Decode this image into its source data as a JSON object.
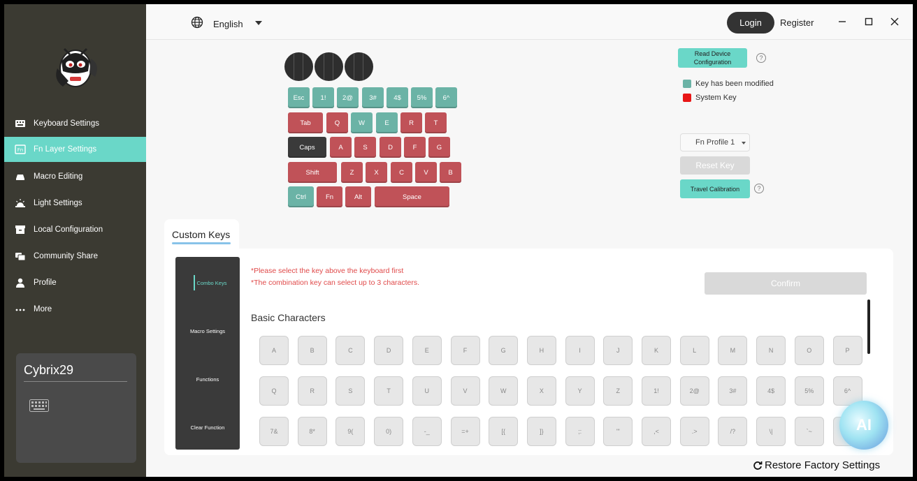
{
  "sidebar": {
    "items": [
      {
        "label": "Keyboard Settings",
        "icon": "keyboard-icon",
        "active": false
      },
      {
        "label": "Fn Layer Settings",
        "icon": "fn-icon",
        "active": true
      },
      {
        "label": "Macro Editing",
        "icon": "macro-icon",
        "active": false
      },
      {
        "label": "Light Settings",
        "icon": "light-icon",
        "active": false
      },
      {
        "label": "Local Configuration",
        "icon": "archive-icon",
        "active": false
      },
      {
        "label": "Community Share",
        "icon": "share-icon",
        "active": false
      },
      {
        "label": "Profile",
        "icon": "user-icon",
        "active": false
      },
      {
        "label": "More",
        "icon": "more-icon",
        "active": false
      }
    ],
    "device": {
      "name": "Cybrix29"
    }
  },
  "topbar": {
    "language": "English",
    "login": "Login",
    "register": "Register"
  },
  "keyboard": {
    "rows": [
      [
        {
          "label": "Esc",
          "state": "teal"
        },
        {
          "label": "1!",
          "state": "teal"
        },
        {
          "label": "2@",
          "state": "teal"
        },
        {
          "label": "3#",
          "state": "teal"
        },
        {
          "label": "4$",
          "state": "teal"
        },
        {
          "label": "5%",
          "state": "teal"
        },
        {
          "label": "6^",
          "state": "teal"
        }
      ],
      [
        {
          "label": "Tab",
          "state": "red"
        },
        {
          "label": "Q",
          "state": "red"
        },
        {
          "label": "W",
          "state": "teal"
        },
        {
          "label": "E",
          "state": "teal"
        },
        {
          "label": "R",
          "state": "red"
        },
        {
          "label": "T",
          "state": "red"
        }
      ],
      [
        {
          "label": "Caps",
          "state": "dark"
        },
        {
          "label": "A",
          "state": "red"
        },
        {
          "label": "S",
          "state": "red"
        },
        {
          "label": "D",
          "state": "red"
        },
        {
          "label": "F",
          "state": "red"
        },
        {
          "label": "G",
          "state": "red"
        }
      ],
      [
        {
          "label": "Shift",
          "state": "red"
        },
        {
          "label": "Z",
          "state": "red"
        },
        {
          "label": "X",
          "state": "red"
        },
        {
          "label": "C",
          "state": "red"
        },
        {
          "label": "V",
          "state": "red"
        },
        {
          "label": "B",
          "state": "red"
        }
      ],
      [
        {
          "label": "Ctrl",
          "state": "teal"
        },
        {
          "label": "Fn",
          "state": "red"
        },
        {
          "label": "Alt",
          "state": "red"
        },
        {
          "label": "Space",
          "state": "red"
        }
      ]
    ]
  },
  "config": {
    "read_device": "Read Device Configuration",
    "legend_modified": "Key has been modified",
    "legend_system": "System Key",
    "fn_profile": "Fn Profile 1",
    "reset_key": "Reset Key",
    "travel_calibration": "Travel Calibration",
    "colors": {
      "modified": "#6bb3a6",
      "system": "#e81616",
      "accent": "#6ad7c8"
    }
  },
  "custom_keys": {
    "tab_label": "Custom Keys",
    "menu": [
      "Combo Keys",
      "Macro Settings",
      "Functions",
      "Clear Function"
    ],
    "warning_1": "*Please select the key above the keyboard first",
    "warning_2": "*The combination key can select up to 3 characters.",
    "confirm": "Confirm",
    "section_title": "Basic Characters",
    "keys": [
      [
        "A",
        "B",
        "C",
        "D",
        "E",
        "F",
        "G",
        "H",
        "I",
        "J",
        "K",
        "L",
        "M",
        "N",
        "O",
        "P"
      ],
      [
        "Q",
        "R",
        "S",
        "T",
        "U",
        "V",
        "W",
        "X",
        "Y",
        "Z",
        "1!",
        "2@",
        "3#",
        "4$",
        "5%",
        "6^"
      ],
      [
        "7&",
        "8*",
        "9(",
        "0)",
        "-_",
        "=+",
        "[{",
        "]}",
        ";:",
        "'\"",
        ",<",
        ".>",
        "/?",
        "\\|",
        "`~",
        ""
      ]
    ]
  },
  "footer": {
    "restore": "Restore Factory Settings",
    "ai_badge": "AI"
  }
}
